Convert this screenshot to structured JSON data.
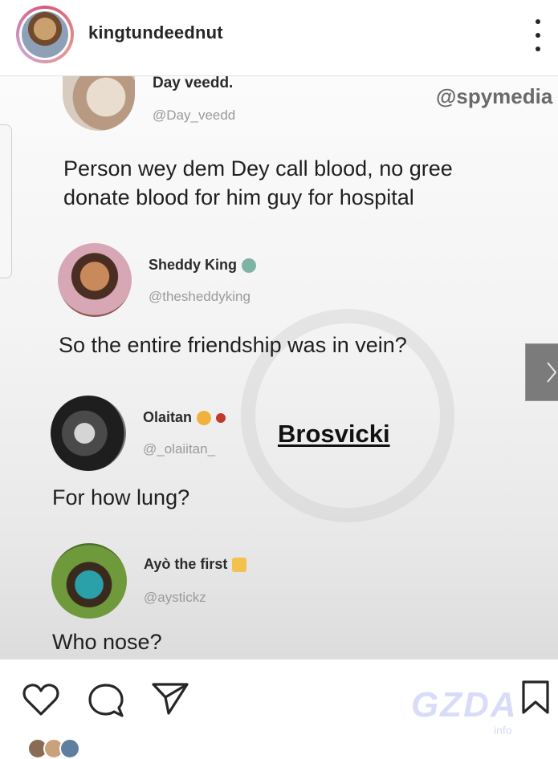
{
  "header": {
    "username": "kingtundeednut"
  },
  "post": {
    "watermark": "@spymedia",
    "overlay_text": "Brosvicki",
    "tweets": [
      {
        "name": "Day veedd.",
        "handle": "@Day_veedd",
        "text_lines": [
          "Person wey dem Dey call blood, no gree",
          "donate blood for him guy for hospital"
        ]
      },
      {
        "name": "Sheddy King",
        "handle": "@thesheddyking",
        "text_lines": [
          "So the entire friendship was in vein?"
        ]
      },
      {
        "name": "Olaitan",
        "handle": "@_olaiitan_",
        "text_lines": [
          "For how lung?"
        ]
      },
      {
        "name": "Ayò the first",
        "handle": "@aystickz",
        "text_lines": [
          "Who nose?"
        ]
      }
    ]
  },
  "footer_watermark": "GZDA",
  "footer_watermark_sub": "info"
}
